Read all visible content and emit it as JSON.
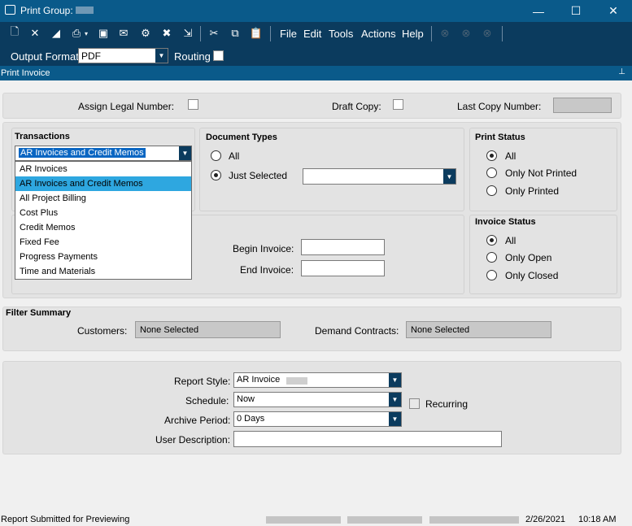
{
  "window": {
    "title": "Print Group:",
    "min_label": "—",
    "max_label": "☐",
    "close_label": "✕"
  },
  "toolbar": {
    "icons": [
      "new-icon",
      "delete-icon",
      "eraser-icon",
      "printer-icon",
      "preview-icon",
      "email-icon",
      "print-settings-icon",
      "tools-icon",
      "export-icon",
      "cut-icon",
      "copy-icon",
      "paste-icon"
    ],
    "menus": [
      "File",
      "Edit",
      "Tools",
      "Actions",
      "Help"
    ]
  },
  "output": {
    "format_label": "Output Format:",
    "format_value": "PDF",
    "routing_label": "Routing"
  },
  "section": {
    "title": "Print Invoice",
    "pin": "📌"
  },
  "top_row": {
    "assign_legal_label": "Assign Legal Number:",
    "draft_copy_label": "Draft Copy:",
    "last_copy_label": "Last Copy Number:"
  },
  "transactions": {
    "header": "Transactions",
    "selected": "AR Invoices and Credit Memos",
    "options": [
      "AR Invoices",
      "AR Invoices and Credit Memos",
      "All Project Billing",
      "Cost Plus",
      "Credit Memos",
      "Fixed Fee",
      "Progress Payments",
      "Time and Materials"
    ],
    "selected_index": 1
  },
  "document_types": {
    "header": "Document Types",
    "all_label": "All",
    "just_selected_label": "Just Selected"
  },
  "print_status": {
    "header": "Print Status",
    "options": [
      "All",
      "Only Not Printed",
      "Only Printed"
    ],
    "selected_index": 0
  },
  "invoice_status": {
    "header": "Invoice Status",
    "options": [
      "All",
      "Only Open",
      "Only Closed"
    ],
    "selected_index": 0
  },
  "invoice_range": {
    "begin_label": "Begin Invoice:",
    "end_label": "End Invoice:"
  },
  "filter_summary": {
    "header": "Filter Summary",
    "customers_label": "Customers:",
    "customers_value": "None Selected",
    "contracts_label": "Demand Contracts:",
    "contracts_value": "None Selected"
  },
  "report": {
    "style_label": "Report Style:",
    "style_value": "AR Invoice",
    "schedule_label": "Schedule:",
    "schedule_value": "Now",
    "recurring_label": "Recurring",
    "archive_label": "Archive Period:",
    "archive_value": "0 Days",
    "desc_label": "User Description:"
  },
  "status_bar": {
    "message": "Report Submitted for Previewing",
    "date": "2/26/2021",
    "time": "10:18 AM"
  }
}
